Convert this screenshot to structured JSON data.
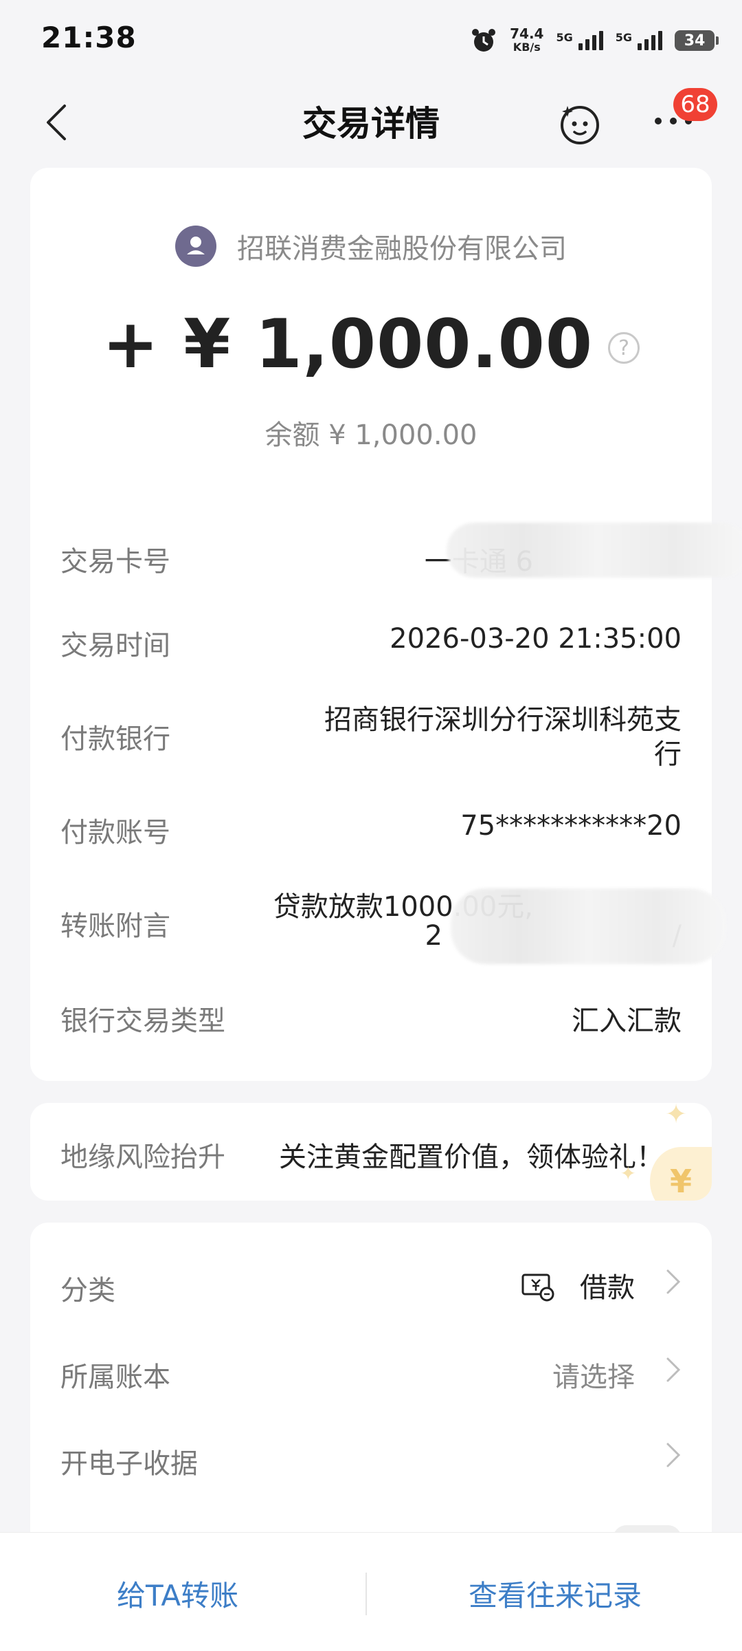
{
  "status_bar": {
    "time": "21:38",
    "net_speed": "74.4",
    "net_unit": "KB/s",
    "sim1": "5G",
    "sim2": "5G",
    "battery": "34"
  },
  "header": {
    "title": "交易详情",
    "badge_count": "68"
  },
  "summary": {
    "company": "招联消费金融股份有限公司",
    "amount": "+ ¥ 1,000.00",
    "help_symbol": "?",
    "balance": "余额 ¥ 1,000.00"
  },
  "details": [
    {
      "label": "交易卡号",
      "value": "一卡通 6"
    },
    {
      "label": "交易时间",
      "value": "2026-03-20 21:35:00"
    },
    {
      "label": "付款银行",
      "value_line1": "招商银行深圳分行深圳科苑支",
      "value_line2": "行"
    },
    {
      "label": "付款账号",
      "value": "75***********20"
    },
    {
      "label": "转账附言",
      "value_line1": "贷款放款1000.00元,",
      "value_line2": "2",
      "value_line2_end": "/"
    },
    {
      "label": "银行交易类型",
      "value": "汇入汇款"
    }
  ],
  "promo": {
    "tag": "地缘风险抬升",
    "text": "关注黄金配置价值，领体验礼！",
    "coin_symbol": "¥",
    "sparkle": "✦"
  },
  "settings": [
    {
      "label": "分类",
      "value": "借款",
      "icon": "loan-category-icon"
    },
    {
      "label": "所属账本",
      "value": "请选择"
    },
    {
      "label": "开电子收据",
      "value": ""
    }
  ],
  "bottom": {
    "transfer": "给TA转账",
    "history": "查看往来记录"
  },
  "colors": {
    "accent_blue": "#3d7ec7",
    "badge_red": "#f04134",
    "label_gray": "#7a7a7a"
  }
}
